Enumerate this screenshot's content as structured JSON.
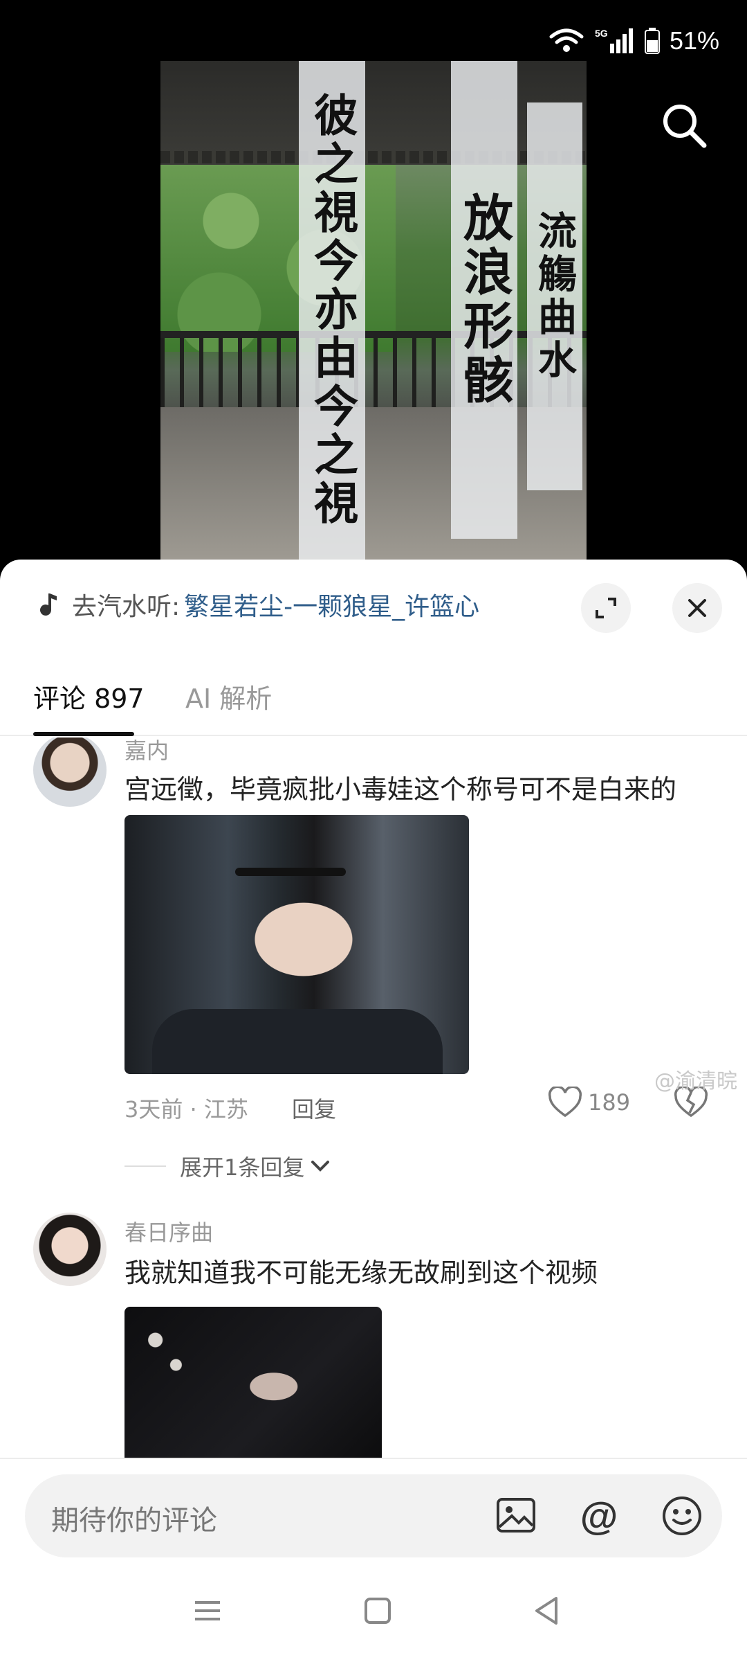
{
  "status": {
    "network": "5G",
    "battery": "51%"
  },
  "video": {
    "banner_left": "彼之視今亦由今之視",
    "banner_mid": "放浪形骸",
    "banner_right": "流觴曲水"
  },
  "music": {
    "prefix": "去汽水听:",
    "song": "繁星若尘-一颗狼星_许篮心"
  },
  "tabs": [
    {
      "label": "评论 897",
      "active": true
    },
    {
      "label": "AI 解析",
      "active": false
    }
  ],
  "comments": [
    {
      "username": "嘉内",
      "text": "宫远徵，毕竟疯批小毒娃这个称号可不是白来的",
      "meta": "3天前 · 江苏",
      "reply_label": "回复",
      "likes": "189",
      "expand_label": "展开1条回复"
    },
    {
      "username": "春日序曲",
      "text": "我就知道我不可能无缘无故刷到这个视频"
    }
  ],
  "input": {
    "placeholder": "期待你的评论"
  },
  "watermark": "@渝清晥"
}
